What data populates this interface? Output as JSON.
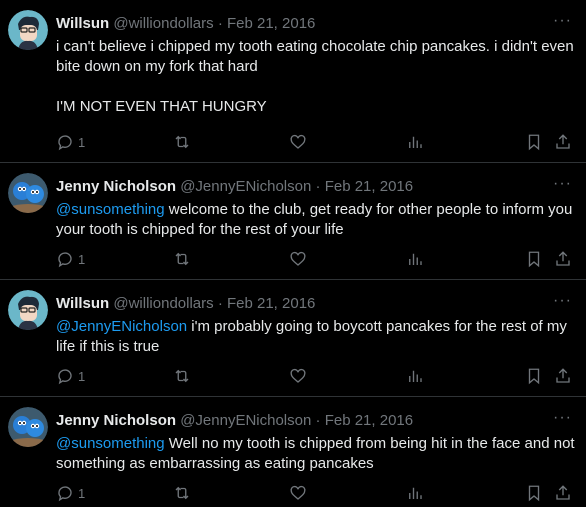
{
  "tweets": [
    {
      "name": "Willsun",
      "handle": "@williondollars",
      "sep": "·",
      "date": "Feb 21, 2016",
      "mention": "",
      "text": "i can't believe i chipped my tooth eating chocolate chip pancakes. i didn't even bite down on my fork that hard\n\nI'M NOT EVEN THAT HUNGRY",
      "reply_count": "1"
    },
    {
      "name": "Jenny Nicholson",
      "handle": "@JennyENicholson",
      "sep": "·",
      "date": "Feb 21, 2016",
      "mention": "@sunsomething",
      "text": " welcome to the club, get ready for other people to inform you your tooth is chipped for the rest of your life",
      "reply_count": "1"
    },
    {
      "name": "Willsun",
      "handle": "@williondollars",
      "sep": "·",
      "date": "Feb 21, 2016",
      "mention": "@JennyENicholson",
      "text": " i'm probably going to boycott pancakes for the rest of my life if this is true",
      "reply_count": "1"
    },
    {
      "name": "Jenny Nicholson",
      "handle": "@JennyENicholson",
      "sep": "·",
      "date": "Feb 21, 2016",
      "mention": "@sunsomething",
      "text": " Well no my tooth is chipped from being hit in the face and not something as embarrassing as eating pancakes",
      "reply_count": "1"
    }
  ],
  "more_label": "···",
  "colors": {
    "background": "#000000",
    "text": "#e7e9ea",
    "muted": "#71767b",
    "link": "#1d9bf0"
  },
  "icons": [
    "reply-icon",
    "retweet-icon",
    "like-icon",
    "views-icon",
    "bookmark-icon",
    "share-icon"
  ]
}
